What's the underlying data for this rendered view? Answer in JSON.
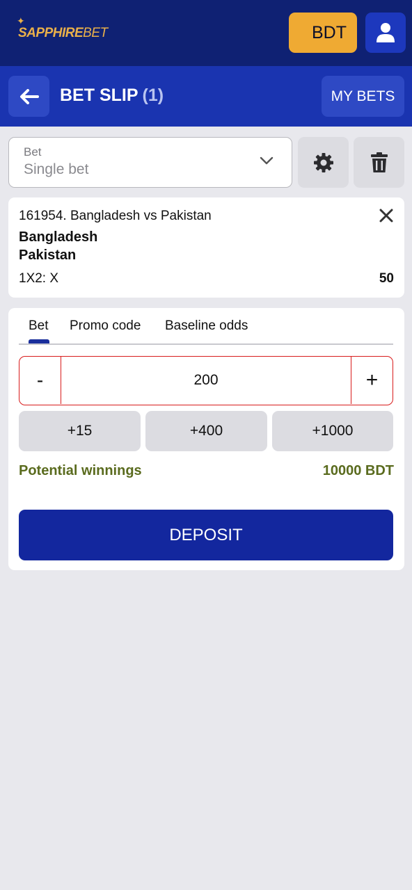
{
  "brand": {
    "logo_primary": "SAPPHIRE",
    "logo_secondary": "BET",
    "accent": "#e9b04a"
  },
  "topbar": {
    "currency_label": "BDT",
    "user_icon": "user-icon",
    "background": "#0f2173"
  },
  "header": {
    "back_icon": "arrow-left-icon",
    "title": "BET SLIP",
    "count": "(1)",
    "my_bets_label": "MY BETS",
    "background": "#1a34b0"
  },
  "bet_type": {
    "label": "Bet",
    "value": "Single bet",
    "settings_icon": "gear-icon",
    "delete_icon": "trash-icon"
  },
  "event": {
    "title": "161954. Bangladesh vs Pakistan",
    "team_home": "Bangladesh",
    "team_away": "Pakistan",
    "market": "1X2: X",
    "odds": "50"
  },
  "tabs": [
    {
      "label": "Bet",
      "active": true
    },
    {
      "label": "Promo code",
      "active": false
    },
    {
      "label": "Baseline odds",
      "active": false
    }
  ],
  "stake": {
    "minus_label": "-",
    "value": "200",
    "plus_label": "+"
  },
  "quick_amounts": [
    "+15",
    "+400",
    "+1000"
  ],
  "winnings": {
    "label": "Potential winnings",
    "value": "10000 BDT",
    "color": "#5a6b1e"
  },
  "deposit_label": "DEPOSIT",
  "colors": {
    "primary": "#13279e",
    "error_border": "#d81b1b",
    "currency_button": "#efaa33"
  }
}
